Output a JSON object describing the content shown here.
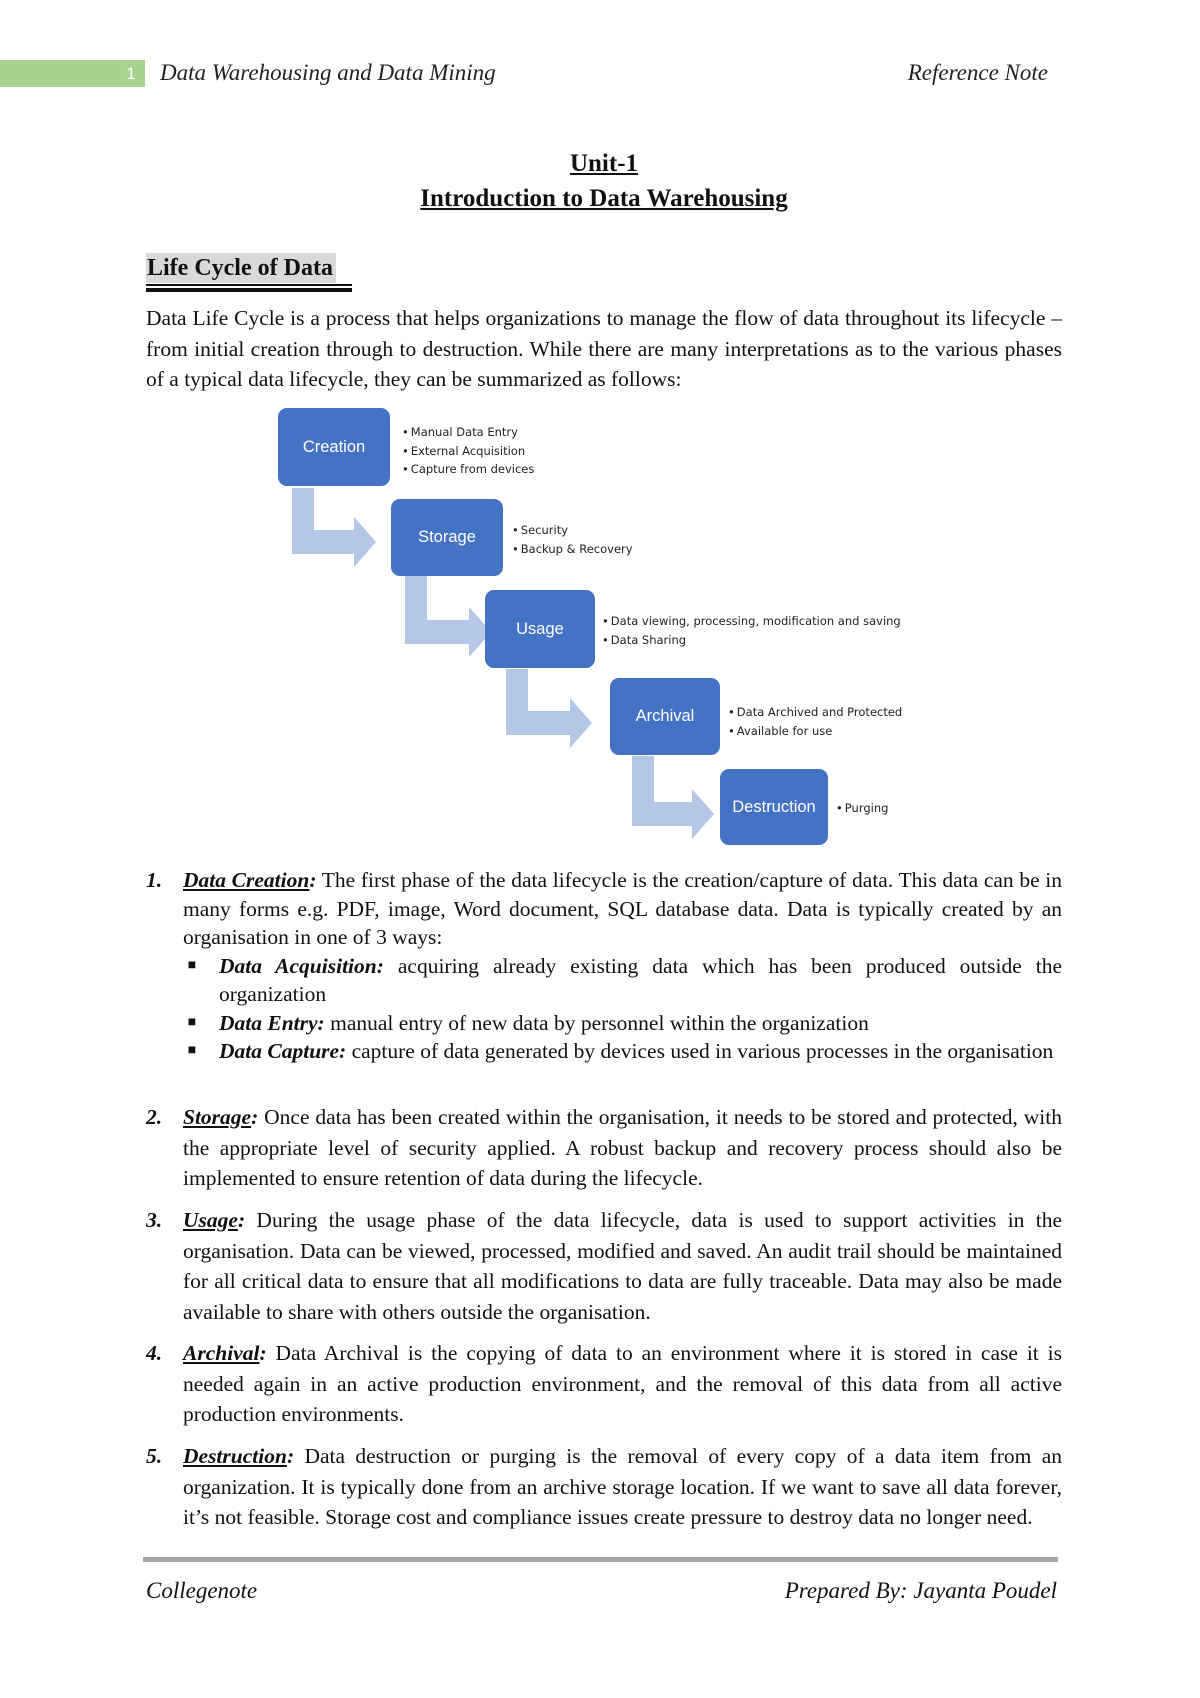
{
  "header": {
    "page_number": "1",
    "course_title": "Data Warehousing and Data Mining",
    "doc_type": "Reference Note",
    "accent_color": "#a9d18e"
  },
  "titles": {
    "unit": "Unit-1",
    "chapter": "Introduction to Data Warehousing"
  },
  "section": {
    "heading": "Life Cycle of Data",
    "intro": "Data Life Cycle is a process that helps organizations to manage the flow of data throughout its lifecycle – from initial creation through to destruction. While there are many interpretations as to the various phases of a typical data lifecycle, they can be summarized as follows:"
  },
  "diagram": {
    "box_color": "#4472c4",
    "arrow_color": "#b4c7e7",
    "steps": [
      {
        "label": "Creation",
        "notes": [
          "Manual Data Entry",
          "External Acquisition",
          "Capture from devices"
        ]
      },
      {
        "label": "Storage",
        "notes": [
          "Security",
          "Backup & Recovery"
        ]
      },
      {
        "label": "Usage",
        "notes": [
          "Data viewing, processing, modification and saving",
          "Data Sharing"
        ]
      },
      {
        "label": "Archival",
        "notes": [
          "Data Archived and Protected",
          "Available for use"
        ]
      },
      {
        "label": "Destruction",
        "notes": [
          "Purging"
        ]
      }
    ]
  },
  "list": [
    {
      "num": "1.",
      "term": "Data Creation",
      "text": " The first phase of the data lifecycle is the creation/capture of data. This data can be in many forms e.g. PDF, image, Word document, SQL database data.  Data is typically created by an organisation in one of 3 ways:",
      "subitems": [
        {
          "term": "Data Acquisition:",
          "text": " acquiring already existing data which has been produced outside the organization"
        },
        {
          "term": "Data Entry:",
          "text": " manual entry of new data by personnel within the organization"
        },
        {
          "term": "Data Capture:",
          "text": " capture of data generated by devices used in various processes in the organisation"
        }
      ]
    },
    {
      "num": "2.",
      "term": "Storage",
      "text": " Once data has been created within the organisation, it needs to be stored and protected, with the appropriate level of security applied. A robust backup and recovery process should also be implemented to ensure retention of data during the lifecycle."
    },
    {
      "num": "3.",
      "term": "Usage",
      "text": " During the usage phase of the data lifecycle, data is used to support activities in the organisation. Data can be viewed, processed, modified and saved. An audit trail should be maintained for all critical data to ensure that all modifications to data are fully traceable. Data may also be made available to share with others outside the organisation."
    },
    {
      "num": "4.",
      "term": "Archival",
      "text": " Data Archival is the copying of data to an environment where it is stored in case it is needed again in an active production environment, and the removal of this data from all active production environments."
    },
    {
      "num": "5.",
      "term": "Destruction",
      "text": " Data destruction or purging is the removal of every copy of a data item from an organization. It is typically done from an archive storage location. If we want to save all data forever, it’s not feasible. Storage cost and compliance issues create pressure to destroy data no longer need."
    }
  ],
  "footer": {
    "left": "Collegenote",
    "right": "Prepared By: Jayanta Poudel"
  }
}
